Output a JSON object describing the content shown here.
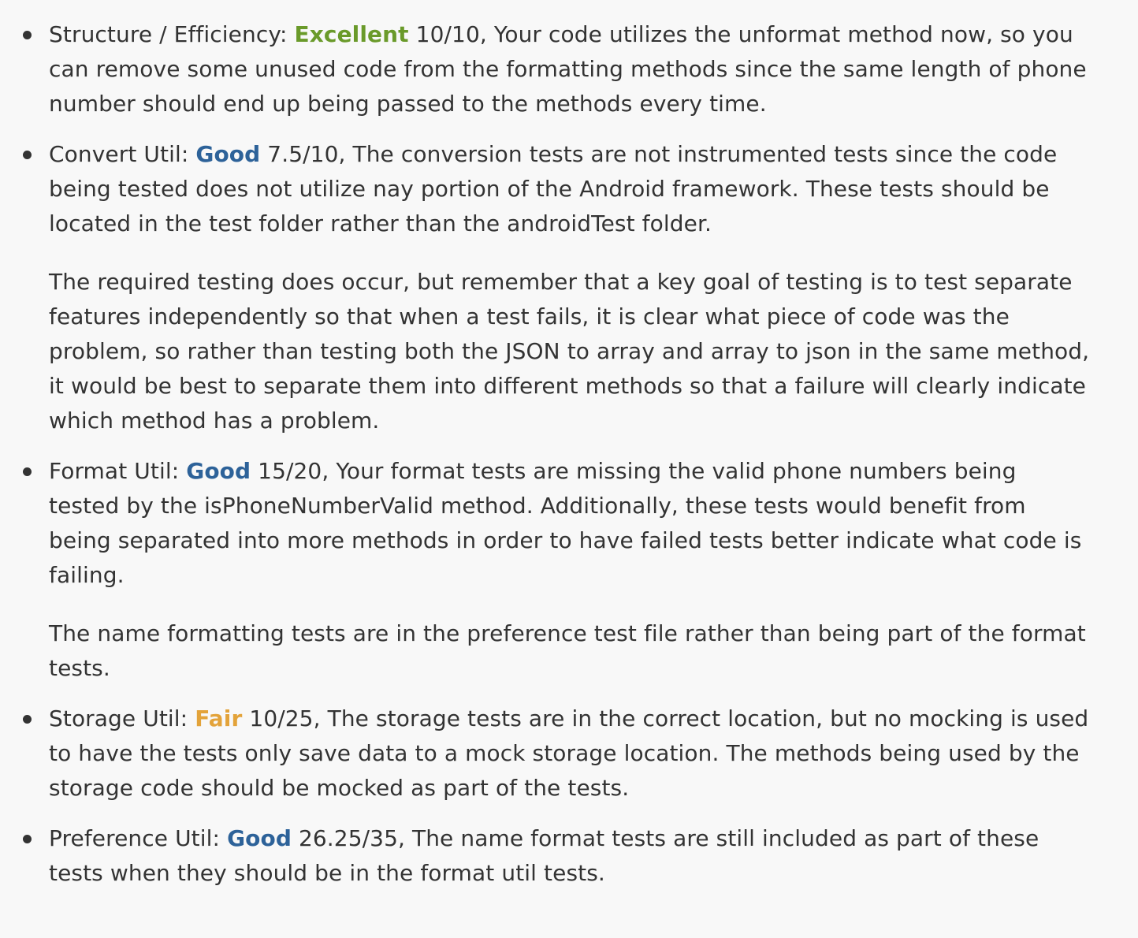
{
  "colors": {
    "text": "#333333",
    "background": "#f8f8f8",
    "excellent": "#6a9a2a",
    "good": "#2d6299",
    "fair": "#e3a33a"
  },
  "items": [
    {
      "label": "Structure / Efficiency: ",
      "rating": "Excellent",
      "rating_level": "excellent",
      "score": " 10/10",
      "text": ", Your code utilizes the unformat method now, so you can remove some unused code from the formatting methods since the same length of phone number should end up being passed to the methods every time.",
      "extra": []
    },
    {
      "label": "Convert Util: ",
      "rating": "Good",
      "rating_level": "good",
      "score": " 7.5/10",
      "text": ", The conversion tests are not instrumented tests since the code being tested does not utilize nay portion of the Android framework. These tests should be located in the test folder rather than the androidTest folder.",
      "extra": [
        "The required testing does occur, but remember that a key goal of testing is to test separate features independently so that when a test fails, it is clear what piece of code was the problem, so rather than testing both the JSON to array and array to json in the same method, it would be best to separate them into different methods so that a failure will clearly indicate which method has a problem."
      ]
    },
    {
      "label": "Format Util: ",
      "rating": "Good",
      "rating_level": "good",
      "score": " 15/20",
      "text": ", Your format tests are missing the valid phone numbers being tested by the isPhoneNumberValid method. Additionally, these tests would benefit from being separated into more methods in order to have failed tests better indicate what code is failing.",
      "extra": [
        "The name formatting tests are in the preference test file rather than being part of the format tests."
      ]
    },
    {
      "label": "Storage Util: ",
      "rating": "Fair",
      "rating_level": "fair",
      "score": " 10/25",
      "text": ", The storage tests are in the correct location, but no mocking is used to have the tests only save data to a mock storage location. The methods being used by the storage code should be mocked as part of the tests.",
      "extra": []
    },
    {
      "label": "Preference Util: ",
      "rating": "Good",
      "rating_level": "good",
      "score": " 26.25/35",
      "text": ", The name format tests are still included as part of these tests when they should be in the format util tests.",
      "extra": []
    }
  ]
}
